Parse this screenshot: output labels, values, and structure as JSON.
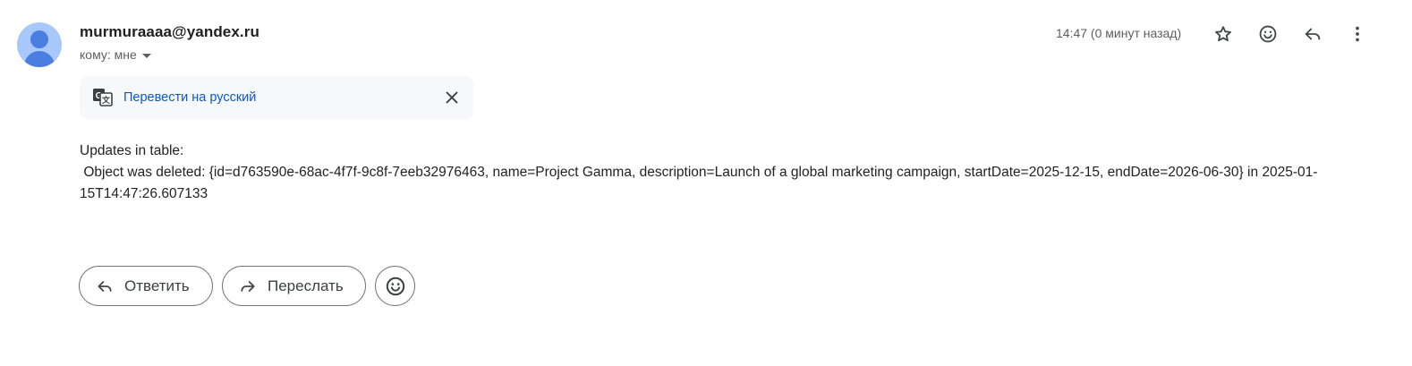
{
  "sender": {
    "email": "murmuraaaa@yandex.ru",
    "recipients_label": "кому: мне"
  },
  "timestamp": "14:47 (0 минут назад)",
  "translate_bar": {
    "link_label": "Перевести на русский"
  },
  "message": {
    "line1": "Updates in table:",
    "line2": " Object was deleted: {id=d763590e-68ac-4f7f-9c8f-7eeb32976463, name=Project Gamma, description=Launch of a global marketing campaign, startDate=2025-12-15, endDate=2026-06-30} in 2025-01-15T14:47:26.607133"
  },
  "actions": {
    "reply_label": "Ответить",
    "forward_label": "Переслать"
  },
  "icons": {
    "top": [
      "star-icon",
      "emoji-icon",
      "reply-icon",
      "more-vert-icon"
    ],
    "translate": "translate-icon",
    "close": "close-icon"
  },
  "colors": {
    "link": "#0b57d0",
    "avatar_bg": "#a8c7fa",
    "avatar_fg": "#4a7de0"
  }
}
